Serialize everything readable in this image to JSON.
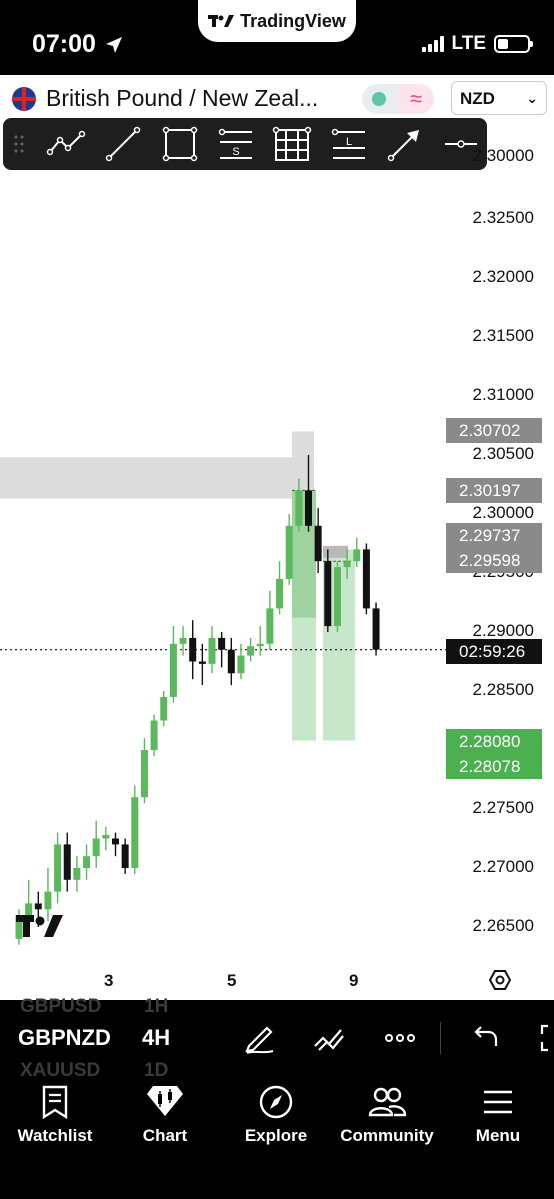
{
  "status_bar": {
    "time": "07:00",
    "carrier_app": "TradingView",
    "network": "LTE"
  },
  "symbol_bar": {
    "title": "British Pound / New Zeal...",
    "currency": "NZD"
  },
  "price_axis": [
    "2.30000",
    "2.32500",
    "2.32000",
    "2.31500",
    "2.31000",
    "2.30500",
    "2.30000",
    "2.29500",
    "2.29000",
    "2.28500",
    "2.28000",
    "2.27500",
    "2.27000",
    "2.26500"
  ],
  "price_tags": {
    "gray_1": "2.30702",
    "gray_2": "2.30197",
    "gray_3": "2.29737",
    "gray_4": "2.29598",
    "countdown": "02:59:26",
    "green_1": "2.28080",
    "green_2": "2.28078"
  },
  "date_labels": [
    "3",
    "5",
    "9"
  ],
  "interval_bar": {
    "symbol": "GBPNZD",
    "interval": "4H",
    "ghost_above_symbol": "GBPUSD",
    "ghost_above_interval": "1H",
    "ghost_below_symbol": "XAUUSD",
    "ghost_below_interval": "1D"
  },
  "tabs": [
    {
      "label": "Watchlist",
      "icon": "watchlist-icon"
    },
    {
      "label": "Chart",
      "icon": "chart-icon"
    },
    {
      "label": "Explore",
      "icon": "compass-icon"
    },
    {
      "label": "Community",
      "icon": "community-icon"
    },
    {
      "label": "Menu",
      "icon": "menu-icon"
    }
  ],
  "colors": {
    "bull_candle": "#5cb85c",
    "bear_candle": "#111111",
    "position_zone": "#c8e6c9",
    "gray_zone": "#dcdcdc"
  },
  "chart_data": {
    "type": "candlestick",
    "interval": "4H",
    "ylim": [
      2.2635,
      2.3305
    ],
    "x_ticks": [
      "3",
      "5",
      "9"
    ],
    "last_price_line": 2.2885,
    "candles": [
      {
        "o": 2.264,
        "c": 2.266,
        "h": 2.2665,
        "l": 2.2635
      },
      {
        "o": 2.266,
        "c": 2.267,
        "h": 2.269,
        "l": 2.2645
      },
      {
        "o": 2.267,
        "c": 2.2665,
        "h": 2.268,
        "l": 2.265
      },
      {
        "o": 2.2665,
        "c": 2.268,
        "h": 2.27,
        "l": 2.2655
      },
      {
        "o": 2.268,
        "c": 2.272,
        "h": 2.273,
        "l": 2.267
      },
      {
        "o": 2.272,
        "c": 2.269,
        "h": 2.273,
        "l": 2.268
      },
      {
        "o": 2.269,
        "c": 2.27,
        "h": 2.271,
        "l": 2.268
      },
      {
        "o": 2.27,
        "c": 2.271,
        "h": 2.272,
        "l": 2.269
      },
      {
        "o": 2.271,
        "c": 2.2725,
        "h": 2.274,
        "l": 2.27
      },
      {
        "o": 2.2725,
        "c": 2.2728,
        "h": 2.2735,
        "l": 2.2715
      },
      {
        "o": 2.2725,
        "c": 2.272,
        "h": 2.273,
        "l": 2.271
      },
      {
        "o": 2.272,
        "c": 2.27,
        "h": 2.2725,
        "l": 2.2695
      },
      {
        "o": 2.27,
        "c": 2.276,
        "h": 2.277,
        "l": 2.2695
      },
      {
        "o": 2.276,
        "c": 2.28,
        "h": 2.281,
        "l": 2.2755
      },
      {
        "o": 2.28,
        "c": 2.2825,
        "h": 2.283,
        "l": 2.2795
      },
      {
        "o": 2.2825,
        "c": 2.2845,
        "h": 2.285,
        "l": 2.282
      },
      {
        "o": 2.2845,
        "c": 2.289,
        "h": 2.2905,
        "l": 2.284
      },
      {
        "o": 2.289,
        "c": 2.2895,
        "h": 2.2905,
        "l": 2.288
      },
      {
        "o": 2.2895,
        "c": 2.2875,
        "h": 2.291,
        "l": 2.286
      },
      {
        "o": 2.2875,
        "c": 2.2873,
        "h": 2.289,
        "l": 2.2855
      },
      {
        "o": 2.2873,
        "c": 2.2895,
        "h": 2.2905,
        "l": 2.2865
      },
      {
        "o": 2.2895,
        "c": 2.2885,
        "h": 2.29,
        "l": 2.287
      },
      {
        "o": 2.2885,
        "c": 2.2865,
        "h": 2.2895,
        "l": 2.2855
      },
      {
        "o": 2.2865,
        "c": 2.288,
        "h": 2.289,
        "l": 2.286
      },
      {
        "o": 2.288,
        "c": 2.2888,
        "h": 2.2895,
        "l": 2.2875
      },
      {
        "o": 2.2888,
        "c": 2.289,
        "h": 2.2905,
        "l": 2.288
      },
      {
        "o": 2.289,
        "c": 2.292,
        "h": 2.2935,
        "l": 2.2885
      },
      {
        "o": 2.292,
        "c": 2.2945,
        "h": 2.296,
        "l": 2.2915
      },
      {
        "o": 2.2945,
        "c": 2.299,
        "h": 2.3,
        "l": 2.294
      },
      {
        "o": 2.299,
        "c": 2.302,
        "h": 2.303,
        "l": 2.2985
      },
      {
        "o": 2.302,
        "c": 2.299,
        "h": 2.305,
        "l": 2.2985
      },
      {
        "o": 2.299,
        "c": 2.296,
        "h": 2.3005,
        "l": 2.295
      },
      {
        "o": 2.296,
        "c": 2.2905,
        "h": 2.297,
        "l": 2.29
      },
      {
        "o": 2.2905,
        "c": 2.2955,
        "h": 2.296,
        "l": 2.29
      },
      {
        "o": 2.2955,
        "c": 2.296,
        "h": 2.297,
        "l": 2.2945
      },
      {
        "o": 2.296,
        "c": 2.297,
        "h": 2.298,
        "l": 2.2955
      },
      {
        "o": 2.297,
        "c": 2.292,
        "h": 2.2975,
        "l": 2.2915
      },
      {
        "o": 2.292,
        "c": 2.2885,
        "h": 2.2925,
        "l": 2.288
      }
    ]
  }
}
